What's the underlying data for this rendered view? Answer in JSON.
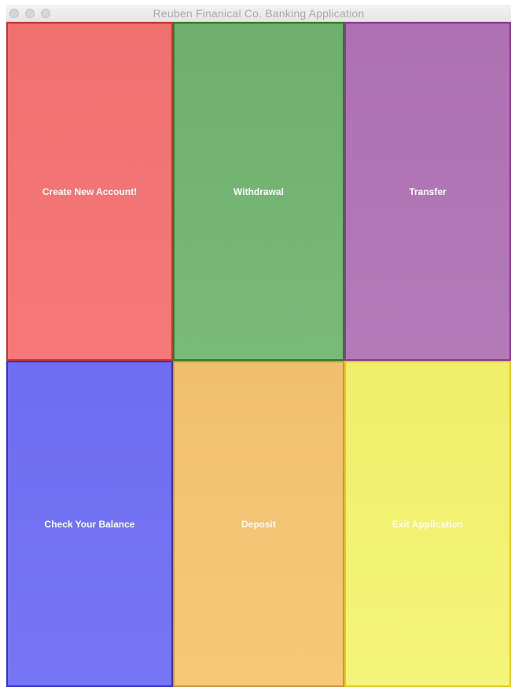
{
  "window": {
    "title": "Reuben Finanical Co. Banking Application"
  },
  "buttons": {
    "create_account": {
      "label": "Create New Account!",
      "color": "#f27474"
    },
    "withdrawal": {
      "label": "Withdrawal",
      "color": "#73b473"
    },
    "transfer": {
      "label": "Transfer",
      "color": "#b075b5"
    },
    "check_balance": {
      "label": "Check Your Balance",
      "color": "#7272f2"
    },
    "deposit": {
      "label": "Deposit",
      "color": "#f3c474"
    },
    "exit": {
      "label": "Exit Application",
      "color": "#f2f172"
    }
  }
}
